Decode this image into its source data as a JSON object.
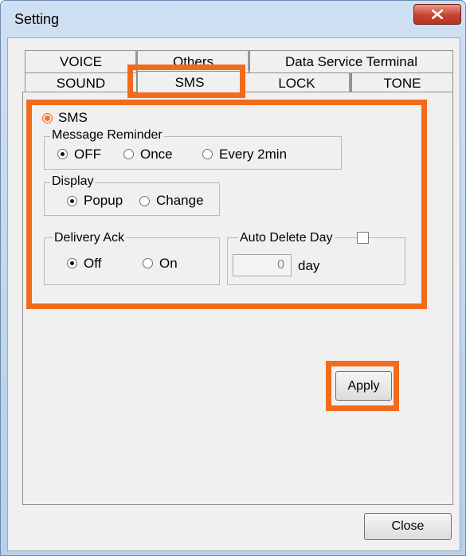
{
  "window": {
    "title": "Setting"
  },
  "tabs": {
    "row1": [
      "VOICE",
      "Others",
      "Data Service Terminal"
    ],
    "row2": [
      "SOUND",
      "SMS",
      "LOCK",
      "TONE"
    ],
    "active": "SMS"
  },
  "sms": {
    "label": "SMS",
    "message_reminder": {
      "title": "Message Reminder",
      "options": [
        "OFF",
        "Once",
        "Every 2min"
      ],
      "selected": "OFF"
    },
    "display": {
      "title": "Display",
      "options": [
        "Popup",
        "Change"
      ],
      "selected": "Popup"
    },
    "delivery_ack": {
      "title": "Delivery Ack",
      "options": [
        "Off",
        "On"
      ],
      "selected": "Off"
    },
    "auto_delete": {
      "title": "Auto Delete Day",
      "checked": false,
      "value": "0",
      "unit": "day"
    }
  },
  "buttons": {
    "apply": "Apply",
    "close": "Close"
  },
  "colors": {
    "highlight": "#f26b1d"
  }
}
